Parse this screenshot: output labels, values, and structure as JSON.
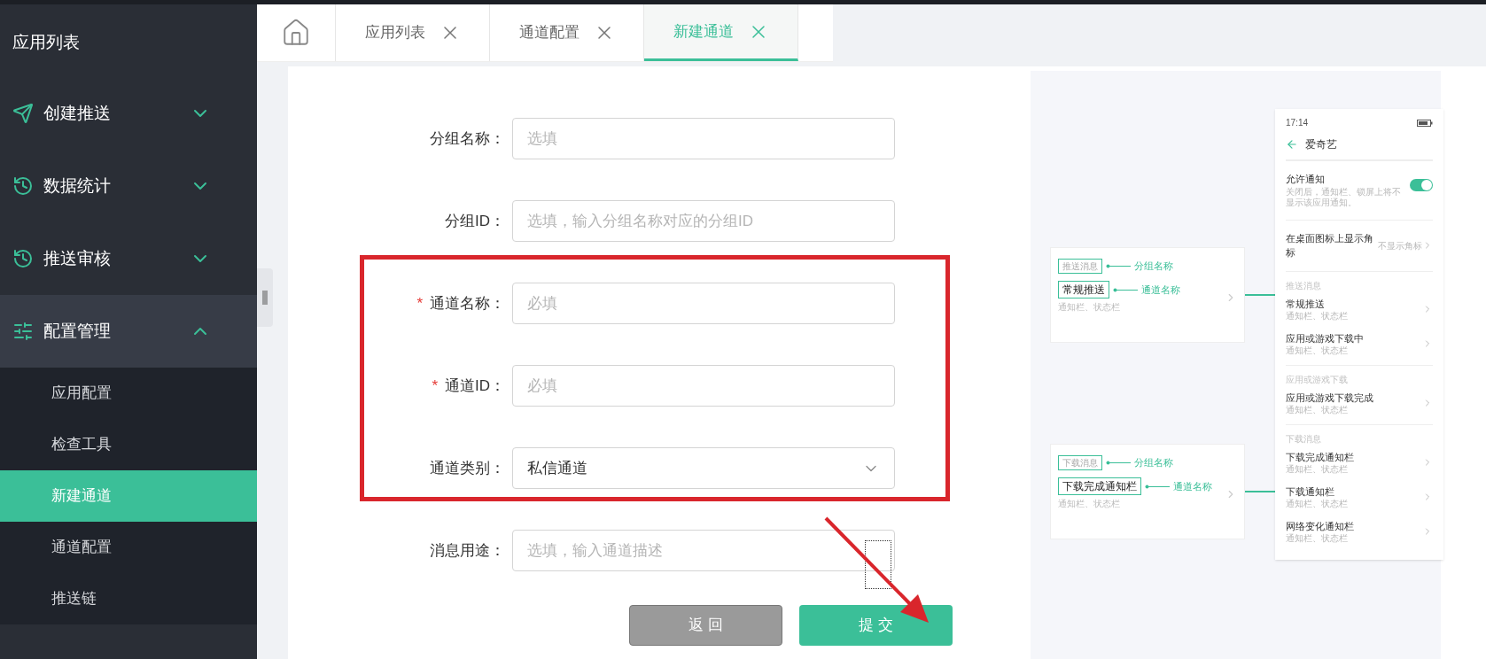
{
  "sidebar": {
    "title": "应用列表",
    "groups": [
      {
        "label": "创建推送",
        "expanded": false
      },
      {
        "label": "数据统计",
        "expanded": false
      },
      {
        "label": "推送审核",
        "expanded": false
      },
      {
        "label": "配置管理",
        "expanded": true,
        "children": [
          {
            "label": "应用配置",
            "selected": false
          },
          {
            "label": "检查工具",
            "selected": false
          },
          {
            "label": "新建通道",
            "selected": true
          },
          {
            "label": "通道配置",
            "selected": false
          },
          {
            "label": "推送链",
            "selected": false
          }
        ]
      }
    ]
  },
  "tabs": [
    {
      "label": "应用列表",
      "selected": false
    },
    {
      "label": "通道配置",
      "selected": false
    },
    {
      "label": "新建通道",
      "selected": true
    }
  ],
  "form": {
    "fields": [
      {
        "label": "分组名称：",
        "kind": "input",
        "placeholder": "选填"
      },
      {
        "label": "分组ID：",
        "kind": "input",
        "placeholder": "选填，输入分组名称对应的分组ID"
      },
      {
        "required_mark": "*",
        "label": "通道名称：",
        "kind": "input",
        "placeholder": "必填"
      },
      {
        "required_mark": "*",
        "label": "通道ID：",
        "kind": "input",
        "placeholder": "必填"
      },
      {
        "label": "通道类别：",
        "kind": "select",
        "value": "私信通道"
      },
      {
        "label": "消息用途：",
        "kind": "textarea",
        "placeholder": "选填，输入通道描述"
      }
    ],
    "buttons": [
      {
        "label": "返 回",
        "kind": "secondary"
      },
      {
        "label": "提 交",
        "kind": "primary"
      }
    ]
  },
  "preview": {
    "callouts": [
      {
        "group_tag": "推送消息",
        "group_note": "分组名称",
        "channel": "常规推送",
        "channel_note": "通道名称",
        "subtitle": "通知栏、状态栏"
      },
      {
        "group_tag": "下载消息",
        "group_note": "分组名称",
        "channel": "下载完成通知栏",
        "channel_note": "通道名称",
        "subtitle": "通知栏、状态栏"
      }
    ],
    "phone": {
      "time": "17:14",
      "title": "爱奇艺",
      "allow": {
        "title": "允许通知",
        "desc": "关闭后，通知栏、锁屏上将不显示该应用通知。",
        "on": true
      },
      "badge": {
        "label": "在桌面图标上显示角标",
        "value": "不显示角标"
      },
      "sections": [
        {
          "header": "推送消息",
          "items": [
            {
              "title": "常规推送",
              "subtitle": "通知栏、状态栏"
            },
            {
              "title": "应用或游戏下载中",
              "subtitle": "通知栏、状态栏"
            }
          ]
        },
        {
          "header": "应用或游戏下载",
          "items": [
            {
              "title": "应用或游戏下载完成",
              "subtitle": "通知栏、状态栏"
            }
          ]
        },
        {
          "header": "下载消息",
          "items": [
            {
              "title": "下载完成通知栏",
              "subtitle": "通知栏、状态栏"
            },
            {
              "title": "下载通知栏",
              "subtitle": "通知栏、状态栏"
            },
            {
              "title": "网络变化通知栏",
              "subtitle": "通知栏、状态栏"
            }
          ]
        }
      ]
    }
  }
}
